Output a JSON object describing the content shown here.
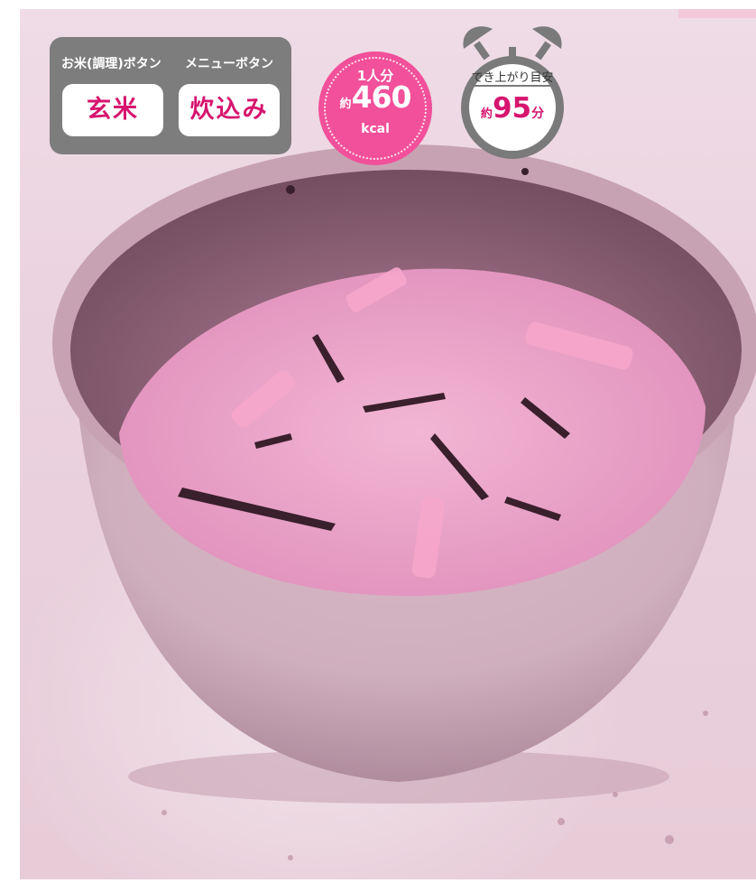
{
  "panel": {
    "rice_header": "お米(調理)ボタン",
    "menu_header": "メニューボタン",
    "rice_button": "玄米",
    "menu_button": "炊込み"
  },
  "calorie": {
    "label": "1人分",
    "prefix": "約",
    "value": "460",
    "unit": "kcal"
  },
  "time": {
    "label": "でき上がり目安",
    "prefix": "約",
    "value": "95",
    "unit": "分"
  },
  "colors": {
    "accent": "#d6156e",
    "badge": "#f2509a",
    "panel": "#7d7d7d"
  }
}
